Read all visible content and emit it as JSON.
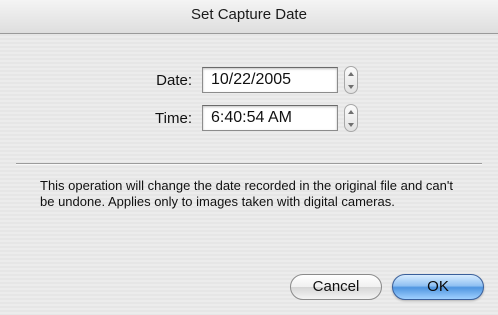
{
  "window": {
    "title": "Set Capture Date"
  },
  "form": {
    "date_label": "Date:",
    "date_value": "10/22/2005",
    "time_label": "Time:",
    "time_value": "6:40:54 AM"
  },
  "message": "This operation will change the date recorded in the original file and can't be undone. Applies only to images taken with digital cameras.",
  "buttons": {
    "cancel_label": "Cancel",
    "ok_label": "OK"
  },
  "colors": {
    "default_button": "#4f95e0",
    "dialog_background": "#ececec"
  },
  "icons": {
    "stepper_up": "chevron-up-icon",
    "stepper_down": "chevron-down-icon"
  }
}
